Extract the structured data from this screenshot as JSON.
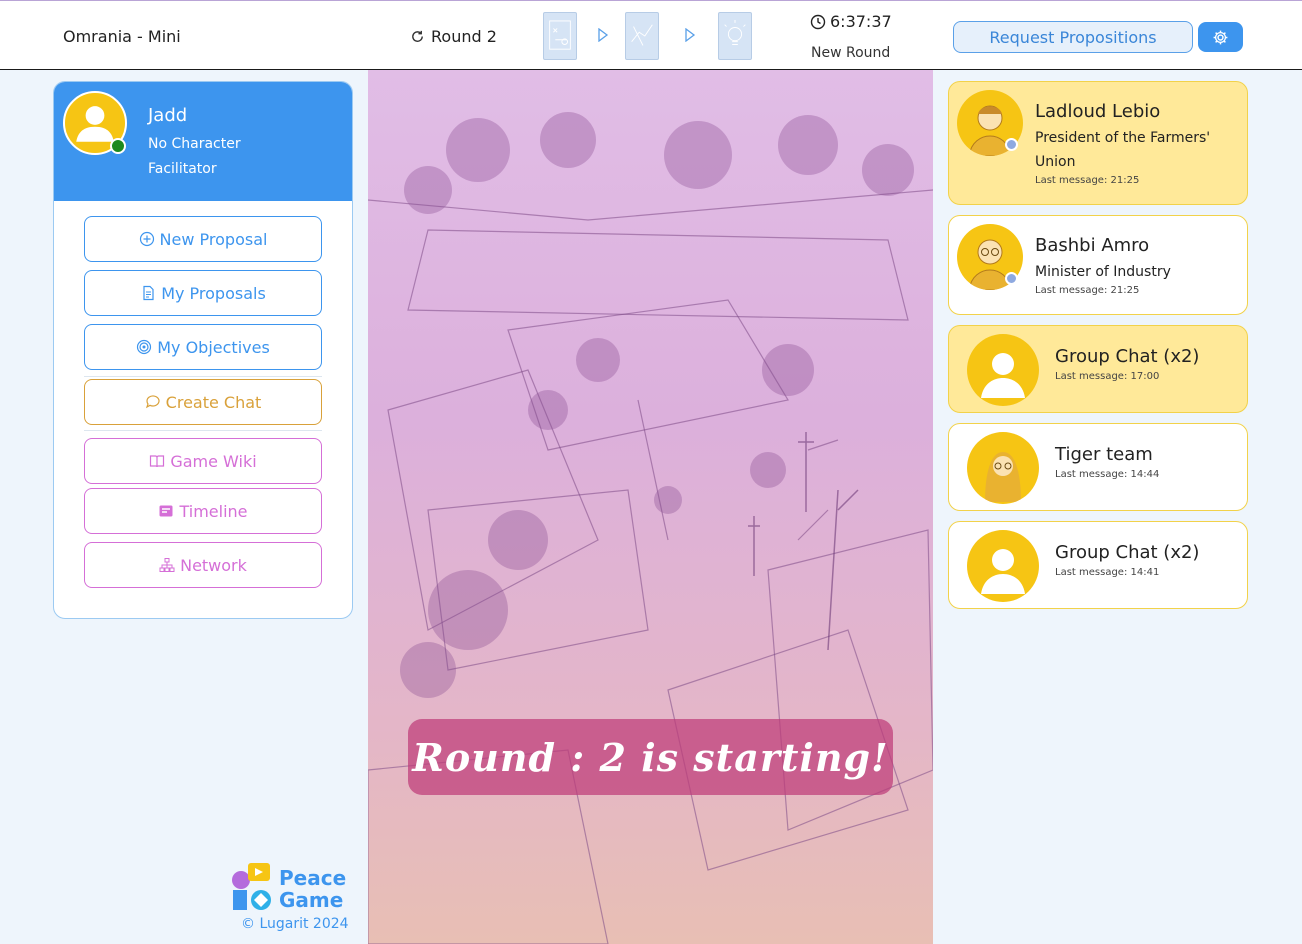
{
  "header": {
    "app_title": "Omrania - Mini",
    "round_label": "Round 2",
    "timer": "6:37:37",
    "round_status": "New Round",
    "request_button": "Request Propositions",
    "icons": [
      "refresh-icon",
      "phase-card-icon",
      "play-arrow-icon",
      "clock-icon",
      "gear-icon"
    ]
  },
  "profile": {
    "name": "Jadd",
    "character": "No Character",
    "role": "Facilitator"
  },
  "menu": {
    "new_proposal": "New Proposal",
    "my_proposals": "My Proposals",
    "my_objectives": "My Objectives",
    "create_chat": "Create Chat",
    "game_wiki": "Game Wiki",
    "timeline": "Timeline",
    "network": "Network"
  },
  "banner": {
    "text": "Round : 2 is starting!"
  },
  "chats": [
    {
      "name": "Ladloud Lebio",
      "role": "President of the Farmers' Union",
      "last": "Last message: 21:25"
    },
    {
      "name": "Bashbi Amro",
      "role": "Minister of Industry",
      "last": "Last message: 21:25"
    },
    {
      "name": "Group Chat (x2)",
      "last": "Last message: 17:00"
    },
    {
      "name": "Tiger team",
      "last": "Last message: 14:44"
    },
    {
      "name": "Group Chat (x2)",
      "last": "Last message: 14:41"
    }
  ],
  "footer": {
    "logo_line1": "Peace",
    "logo_line2": "Game",
    "copyright": "© Lugarit 2024"
  },
  "colors": {
    "primary": "#3d95ee",
    "chat_highlight": "#ffe999",
    "chat_border": "#f2d24a",
    "create_chat": "#d9a13a",
    "tools": "#d56fd7",
    "page_bg": "#eef5fc"
  }
}
